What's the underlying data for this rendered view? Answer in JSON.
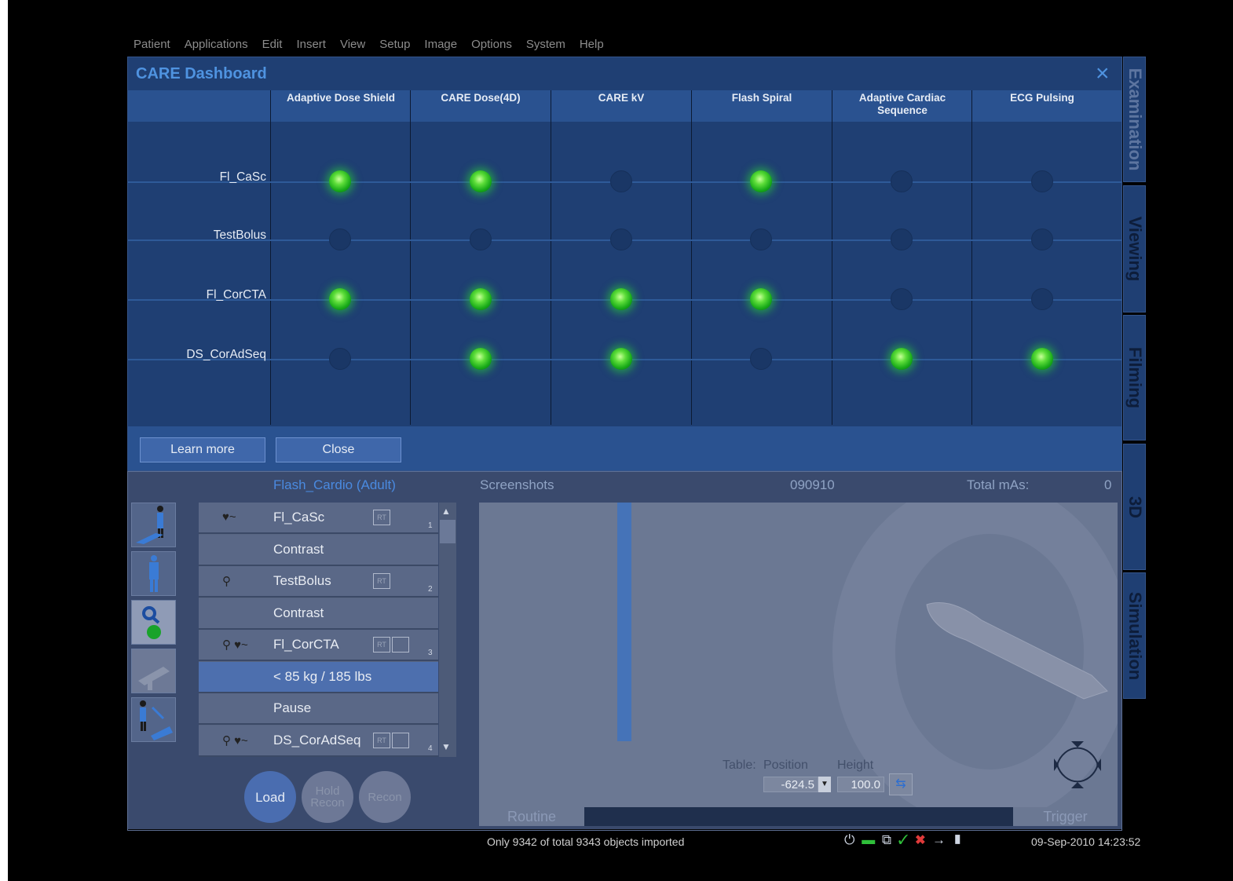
{
  "menu": [
    "Patient",
    "Applications",
    "Edit",
    "Insert",
    "View",
    "Setup",
    "Image",
    "Options",
    "System",
    "Help"
  ],
  "dashboard": {
    "title": "CARE Dashboard",
    "close_icon": "×",
    "columns": [
      "Adaptive Dose Shield",
      "CARE Dose(4D)",
      "CARE kV",
      "Flash Spiral",
      "Adaptive Cardiac Sequence",
      "ECG Pulsing"
    ],
    "rows": [
      {
        "label": "Fl_CaSc",
        "states": [
          1,
          1,
          0,
          1,
          0,
          0
        ]
      },
      {
        "label": "TestBolus",
        "states": [
          0,
          0,
          0,
          0,
          0,
          0
        ]
      },
      {
        "label": "Fl_CorCTA",
        "states": [
          1,
          1,
          1,
          1,
          0,
          0
        ]
      },
      {
        "label": "DS_CorAdSeq",
        "states": [
          0,
          1,
          1,
          0,
          1,
          1
        ]
      }
    ],
    "learn_more": "Learn more",
    "close": "Close",
    "led_on_color": "#3fcf3a"
  },
  "lower": {
    "protocol": "Flash_Cardio (Adult)",
    "screenshots": "Screenshots",
    "code": "090910",
    "total_mas_label": "Total mAs:",
    "total_mas_value": "0",
    "list": [
      {
        "text": "Fl_CaSc",
        "rt": "RT",
        "num": "1"
      },
      {
        "text": "Contrast"
      },
      {
        "text": "TestBolus",
        "rt": "RT",
        "num": "2"
      },
      {
        "text": "Contrast"
      },
      {
        "text": "Fl_CorCTA",
        "rt": "RT",
        "num": "3"
      },
      {
        "text": "< 85 kg / 185 lbs"
      },
      {
        "text": "Pause"
      },
      {
        "text": "DS_CorAdSeq",
        "rt": "RT",
        "num": "4"
      }
    ],
    "buttons": {
      "load": "Load",
      "hold_recon_1": "Hold",
      "hold_recon_2": "Recon",
      "recon": "Recon"
    },
    "table": {
      "label": "Table:",
      "position_label": "Position",
      "height_label": "Height",
      "position": "-624.5",
      "height": "100.0"
    },
    "routine": "Routine",
    "trigger": "Trigger"
  },
  "tabs": [
    "Examination",
    "Viewing",
    "Filming",
    "3D",
    "Simulation"
  ],
  "status": {
    "message": "Only 9342 of total 9343 objects imported",
    "clock": "09-Sep-2010 14:23:52"
  }
}
